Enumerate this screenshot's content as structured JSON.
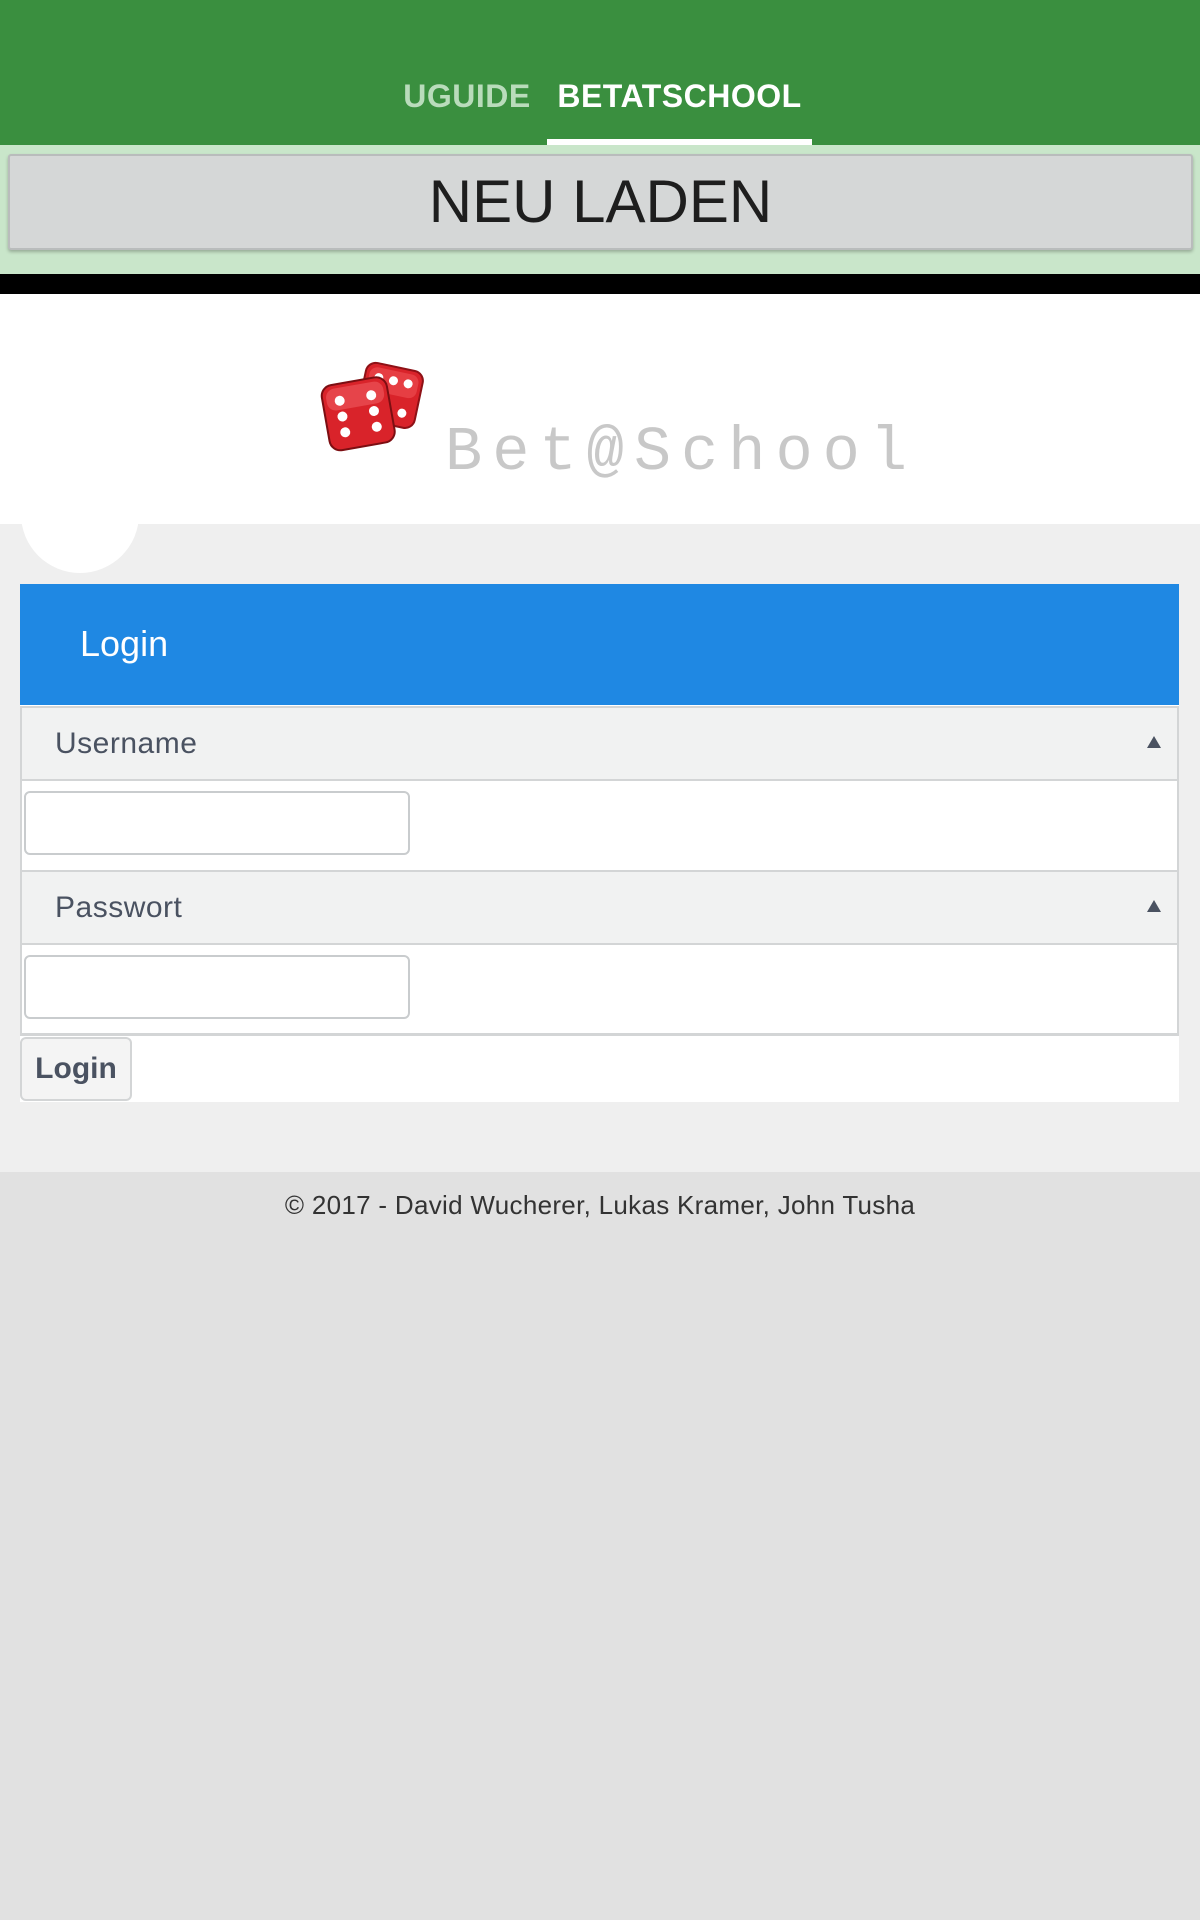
{
  "tabs": [
    {
      "label": "UGUIDE",
      "active": false
    },
    {
      "label": "BETATSCHOOL",
      "active": true
    }
  ],
  "reload_button": {
    "label": "NEU LADEN"
  },
  "logo": {
    "text": "Bet@School",
    "icon": "dice-icon"
  },
  "login": {
    "title": "Login",
    "fields": [
      {
        "label": "Username",
        "value": "",
        "placeholder": ""
      },
      {
        "label": "Passwort",
        "value": "",
        "placeholder": ""
      }
    ],
    "submit_label": "Login"
  },
  "footer": {
    "text": "© 2017 - David Wucherer, Lukas Kramer, John Tusha"
  },
  "colors": {
    "tab_bar": "#3a8f3f",
    "reload_strip": "#c9e6ca",
    "login_header": "#1f88e3",
    "dice": "#d9232a"
  }
}
